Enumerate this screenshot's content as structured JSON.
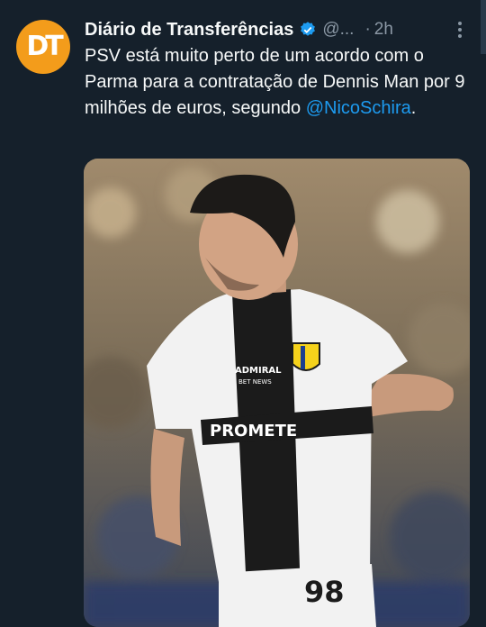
{
  "author": {
    "display_name": "Diário de Transferências",
    "handle": "@...",
    "time": "2h",
    "avatar_text": "DT"
  },
  "tweet": {
    "text_before": "PSV está muito perto de um acordo com o Parma para a contratação de Dennis Man por 9 milhões de euros, segundo ",
    "mention": "@NicoSchira",
    "text_after": "."
  },
  "media": {
    "shirt_number": "98",
    "sponsor_text": "PROMETE",
    "sleeve_sponsor": "ADMIRAL",
    "sleeve_sub": "BET NEWS"
  },
  "colors": {
    "background": "#15202b",
    "avatar": "#f39c1b",
    "link": "#1d9bf0",
    "muted": "#8b98a5",
    "verified": "#1d9bf0"
  },
  "icons": [
    "verified-badge-icon",
    "more-options-icon"
  ]
}
